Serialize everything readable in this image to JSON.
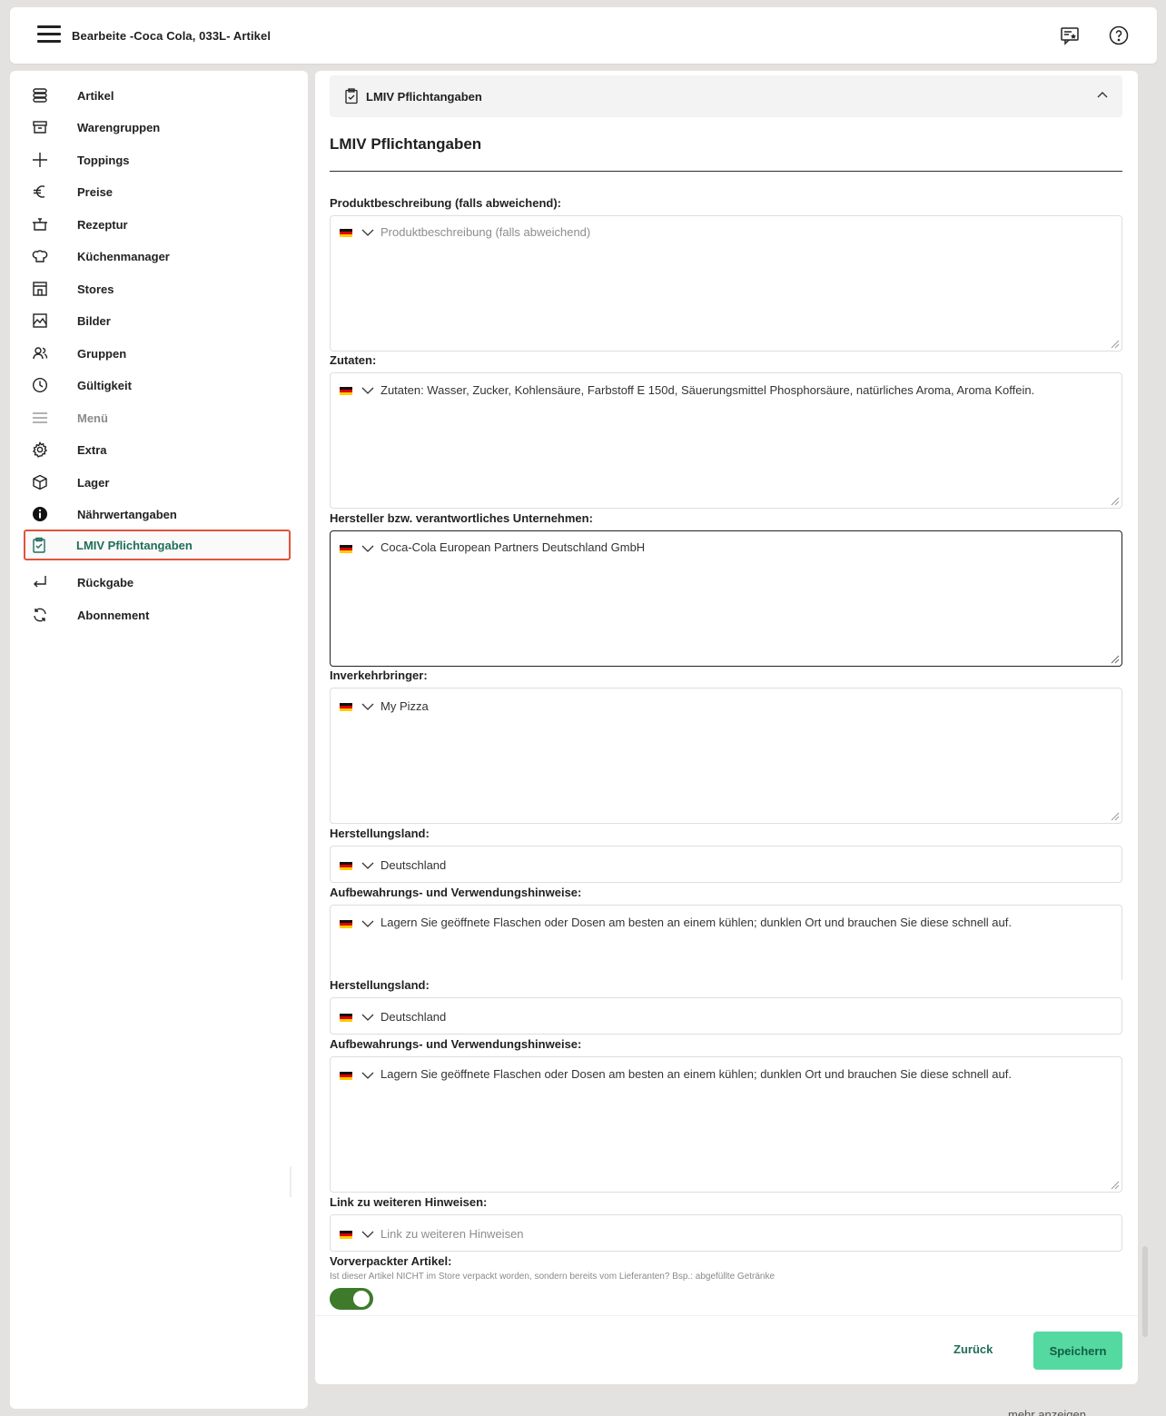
{
  "header": {
    "title": "Bearbeite -Coca Cola, 033L- Artikel",
    "icons": [
      "menu-icon",
      "feedback-icon",
      "help-icon"
    ]
  },
  "sidebar": {
    "items": [
      {
        "label": "Artikel",
        "icon": "stack-icon"
      },
      {
        "label": "Warengruppen",
        "icon": "archive-icon"
      },
      {
        "label": "Toppings",
        "icon": "plus-icon"
      },
      {
        "label": "Preise",
        "icon": "euro-icon"
      },
      {
        "label": "Rezeptur",
        "icon": "pot-icon"
      },
      {
        "label": "Küchenmanager",
        "icon": "chef-hat-icon"
      },
      {
        "label": "Stores",
        "icon": "store-icon"
      },
      {
        "label": "Bilder",
        "icon": "image-icon"
      },
      {
        "label": "Gruppen",
        "icon": "users-icon"
      },
      {
        "label": "Gültigkeit",
        "icon": "clock-icon"
      },
      {
        "label": "Menü",
        "icon": "list-icon"
      },
      {
        "label": "Extra",
        "icon": "gear-icon"
      },
      {
        "label": "Lager",
        "icon": "box-icon"
      },
      {
        "label": "Nährwertangaben",
        "icon": "info-icon"
      },
      {
        "label": "LMIV Pflichtangaben",
        "icon": "clipboard-check-icon"
      },
      {
        "label": "Rückgabe",
        "icon": "return-icon"
      },
      {
        "label": "Abonnement",
        "icon": "refresh-icon"
      }
    ],
    "active": "LMIV Pflichtangaben",
    "muted": "Menü"
  },
  "main": {
    "accordion_title": "LMIV Pflichtangaben",
    "section_title": "LMIV Pflichtangaben",
    "fields": [
      {
        "label": "Produktbeschreibung (falls abweichend):",
        "value": "",
        "placeholder": "Produktbeschreibung (falls abweichend)"
      },
      {
        "label": "Zutaten:",
        "value": "Zutaten: Wasser, Zucker, Kohlensäure, Farbstoff E 150d, Säuerungsmittel Phosphorsäure, natürliches Aroma, Aroma Koffein.",
        "placeholder": ""
      },
      {
        "label": "Hersteller bzw. verantwortliches Unternehmen:",
        "value": "Coca-Cola European Partners Deutschland GmbH",
        "placeholder": ""
      },
      {
        "label": "Inverkehrbringer:",
        "value": "My Pizza",
        "placeholder": ""
      },
      {
        "label": "Herstellungsland:",
        "value": "Deutschland",
        "placeholder": ""
      },
      {
        "label": "Aufbewahrungs- und Verwendungshinweise:",
        "value": "Lagern Sie geöffnete Flaschen oder Dosen am besten an einem kühlen; dunklen Ort und brauchen Sie diese schnell auf.",
        "placeholder": ""
      },
      {
        "label": "Herstellungsland:",
        "value": "Deutschland",
        "placeholder": ""
      },
      {
        "label": "Aufbewahrungs- und Verwendungshinweise:",
        "value": "Lagern Sie geöffnete Flaschen oder Dosen am besten an einem kühlen; dunklen Ort und brauchen Sie diese schnell auf.",
        "placeholder": ""
      },
      {
        "label": "Link zu weiteren Hinweisen:",
        "value": "",
        "placeholder": "Link zu weiteren Hinweisen"
      }
    ],
    "prepackaged": {
      "label": "Vorverpackter Artikel:",
      "hint": "Ist dieser Artikel NICHT im Store verpackt worden, sondern bereits vom Lieferanten? Bsp.: abgefüllte Getränke",
      "checked": true
    },
    "buttons": {
      "back": "Zurück",
      "save": "Speichern"
    }
  },
  "footer_text": "mehr anzeigen",
  "colors": {
    "accent": "#1f6e5a",
    "save_bg": "#54d9a0",
    "toggle_on": "#3d7a2a",
    "active_border": "#e0533c"
  }
}
